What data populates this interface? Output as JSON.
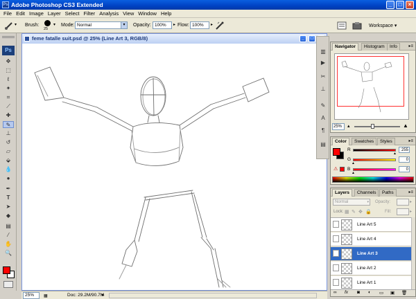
{
  "window": {
    "title": "Adobe Photoshop CS3 Extended",
    "app_icon": "Ps",
    "minimize": "_",
    "maximize": "□",
    "close": "×"
  },
  "menu": [
    "File",
    "Edit",
    "Image",
    "Layer",
    "Select",
    "Filter",
    "Analysis",
    "View",
    "Window",
    "Help"
  ],
  "options": {
    "brush_label": "Brush:",
    "brush_size": "25",
    "mode_label": "Mode:",
    "mode_value": "Normal",
    "opacity_label": "Opacity:",
    "opacity_value": "100%",
    "flow_label": "Flow:",
    "flow_value": "100%",
    "workspace_label": "Workspace ▾"
  },
  "toolbox": {
    "logo": "Ps"
  },
  "document": {
    "title": "feme fatalle suit.psd @ 25% (Line Art 3, RGB/8)",
    "zoom": "25%",
    "doc_info": "Doc: 29.2M/90.7M"
  },
  "navigator": {
    "tabs": [
      "Navigator",
      "Histogram",
      "Info"
    ],
    "zoom": "25%"
  },
  "color": {
    "tabs": [
      "Color",
      "Swatches",
      "Styles"
    ],
    "fg_color": "#ff0000",
    "channels": [
      {
        "label": "R",
        "value": "255"
      },
      {
        "label": "G",
        "value": "0"
      },
      {
        "label": "B",
        "value": "0"
      }
    ]
  },
  "layers": {
    "tabs": [
      "Layers",
      "Channels",
      "Paths"
    ],
    "blend_mode": "Normal",
    "opacity_label": "Opacity:",
    "lock_label": "Lock:",
    "fill_label": "Fill:",
    "items": [
      {
        "name": "Line Art 5",
        "selected": false
      },
      {
        "name": "Line Art 4",
        "selected": false
      },
      {
        "name": "Line Art 3",
        "selected": true
      },
      {
        "name": "Line Art 2",
        "selected": false
      },
      {
        "name": "Line Art 1",
        "selected": false
      }
    ]
  }
}
